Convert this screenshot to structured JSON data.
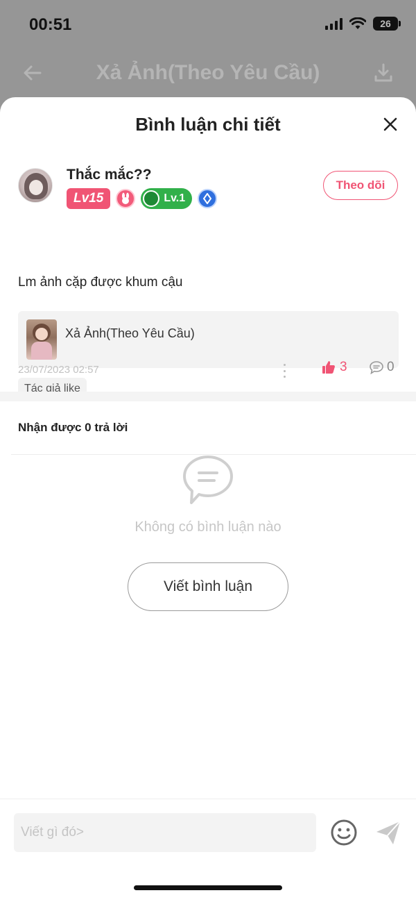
{
  "status_bar": {
    "time": "00:51",
    "battery": "26"
  },
  "background_nav": {
    "title": "Xả Ảnh(Theo Yêu Cầu)"
  },
  "sheet": {
    "title": "Bình luận chi tiết"
  },
  "post": {
    "username": "Thắc mắc??",
    "level_badge": "Lv15",
    "green_level": "Lv.1",
    "follow_label": "Theo dõi",
    "content": "Lm ảnh cặp được khum cậu",
    "reference_title": "Xả Ảnh(Theo Yêu Cầu)",
    "author_like_tag": "Tác giả like",
    "date": "23/07/2023 02:57",
    "like_count": "3",
    "comment_count": "0"
  },
  "replies": {
    "header": "Nhận được 0 trả lời",
    "empty_text": "Không có bình luận nào",
    "write_button": "Viết bình luận"
  },
  "bottom_bar": {
    "input_placeholder": "Viết gì đó>"
  },
  "colors": {
    "accent": "#f05474",
    "level_green": "#31b04a",
    "badge_blue": "#2f6fde"
  }
}
